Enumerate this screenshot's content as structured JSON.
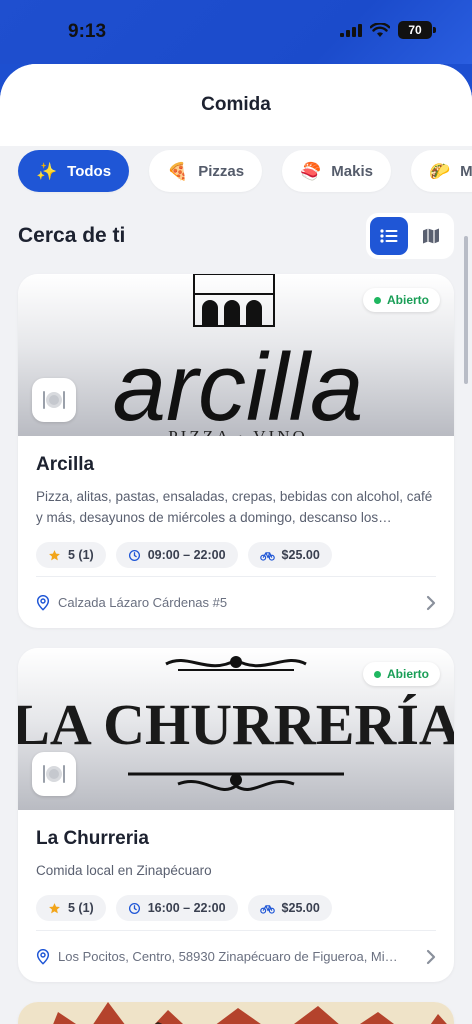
{
  "status_bar": {
    "time": "9:13",
    "battery": "70"
  },
  "header": {
    "title": "Comida"
  },
  "categories": [
    {
      "label": "Todos",
      "icon": "sparkles-icon",
      "glyph": "✨",
      "active": true
    },
    {
      "label": "Pizzas",
      "icon": "pizza-icon",
      "glyph": "🍕",
      "active": false
    },
    {
      "label": "Makis",
      "icon": "sushi-icon",
      "glyph": "🍣",
      "active": false
    },
    {
      "label": "M",
      "icon": "taco-icon",
      "glyph": "🌮",
      "active": false
    }
  ],
  "section": {
    "title": "Cerca de ti"
  },
  "restaurants": [
    {
      "name": "Arcilla",
      "banner_text": "arcilla",
      "banner_subtext": "PIZZA · VINO",
      "status": "Abierto",
      "description": "Pizza, alitas, pastas, ensaladas, crepas, bebidas con alcohol, café y más, desayunos de miércoles a domingo, descanso los…",
      "rating": "5 (1)",
      "hours": "09:00 – 22:00",
      "delivery": "$25.00",
      "address": "Calzada Lázaro Cárdenas #5"
    },
    {
      "name": "La Churreria",
      "banner_text": "LA CHURRERÍA",
      "status": "Abierto",
      "description": "Comida local en Zinapécuaro",
      "rating": "5 (1)",
      "hours": "16:00 – 22:00",
      "delivery": "$25.00",
      "address": "Los Pocitos, Centro, 58930 Zinapécuaro de Figueroa, Mi…"
    }
  ],
  "colors": {
    "accent": "#1f56d6",
    "open": "#1a9e57",
    "star": "#f2a51a"
  }
}
